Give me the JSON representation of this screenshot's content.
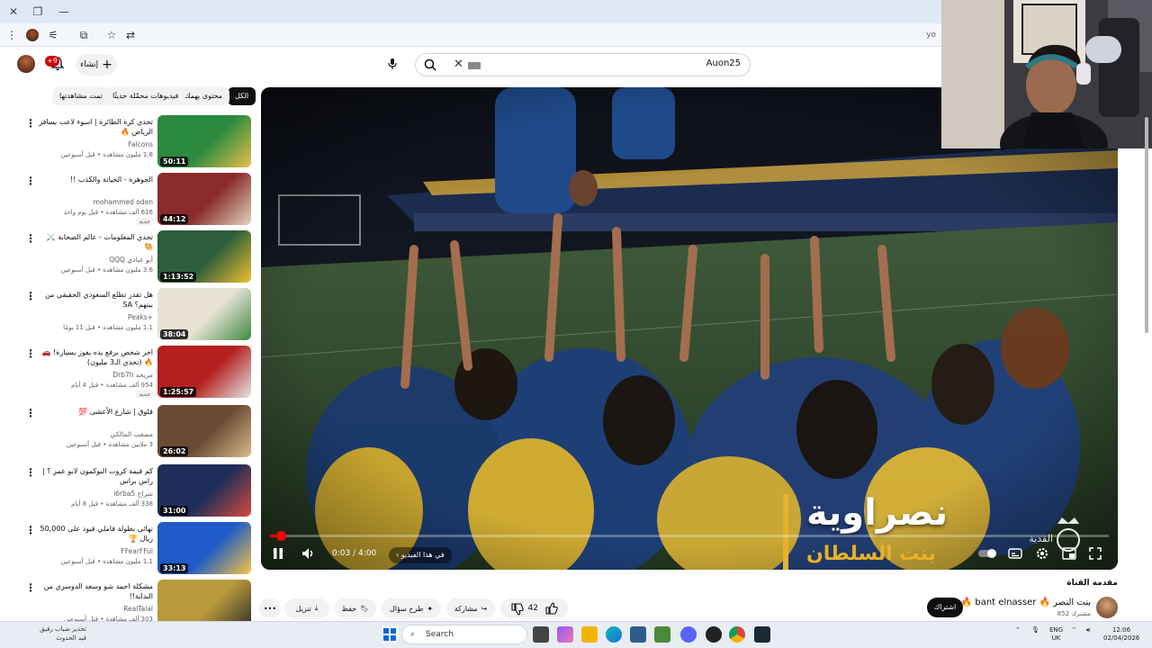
{
  "browser": {
    "url_fragment": "yo"
  },
  "header": {
    "notification_badge": "+9",
    "create_label": "إنشاء",
    "search_value": "Auon25"
  },
  "chips": [
    "الكل",
    "محتوى يهمك",
    "فيديوهات محمّلة حديثًا",
    "تمت مشاهدتها"
  ],
  "recommendations": [
    {
      "title": "تحدي كرة الطائرة | اسوء لاعب يسافر الرياض 🔥",
      "channel": "Falcons",
      "meta": "1.8 مليون مشاهدة • قبل أسبوعين",
      "duration": "50:11"
    },
    {
      "title": "الجوهرة - الخيانة والكذب !!",
      "channel": "mohammed oden",
      "meta": "616 ألف مشاهدة • قبل يوم واحد",
      "badge": "جديد",
      "duration": "44:12"
    },
    {
      "title": "تحدي المعلومات - عالم الصحابة ⚔️ 🐫",
      "channel": "QQQ أبو عبادي",
      "meta": "3.6 مليون مشاهدة • قبل أسبوعين",
      "duration": "1:13:52"
    },
    {
      "title": "هل تقدر تطلع السعودي الحقيقي من بينهم؟ SA",
      "channel": "Peaks+",
      "meta": "1.1 مليون مشاهدة • قبل 11 يومًا",
      "duration": "38:04"
    },
    {
      "title": "اخر شخص يرفع يده يفوز بسيارة! 🚗 🔥 (تحدي الـ3 مليون)",
      "channel": "Drb7h مريخه",
      "meta": "954 ألف مشاهدة • قبل 4 أيام",
      "badge": "جديد",
      "duration": "1:25:57"
    },
    {
      "title": "قلوق | شارع الأعشى 💯",
      "channel": "مصعب المالكي",
      "meta": "3 ملايين مشاهدة • قبل أسبوعين",
      "duration": "26:02"
    },
    {
      "title": "كم قيمة كروت البوكمون لابو عمر ؟ | راس براس",
      "channel": "i6rba5 شراح",
      "meta": "338 ألف مشاهدة • قبل 8 أيام",
      "duration": "31:00"
    },
    {
      "title": "نهائي بطولة فاملي فيود على 50,000 ريال 🏆",
      "channel": "FFearFFul",
      "meta": "1.1 مليون مشاهدة • قبل أسبوعين",
      "duration": "33:13"
    },
    {
      "title": "مشكلة احمد شو وسعد الدوسري من البداية!!",
      "channel": "RealTalal",
      "meta": "303 ألف مشاهدة • قبل أسبوعين",
      "duration": ""
    }
  ],
  "player": {
    "time": "0:03 / 4:00",
    "progress": 0.0125,
    "chapter_label": "في هذا الفيديو",
    "caption_main": "نصراوية",
    "caption_sub": "بنت السلطان",
    "watermark": "القدية"
  },
  "below": {
    "section_title": "مقدمة القناة",
    "channel_name": "بنت النصر 🔥 bant elnasser 🔥",
    "subscribers": "852 مشترك",
    "subscribe_label": "اشتراك",
    "likes": "42",
    "share_label": "مشاركة",
    "ask_label": "طرح سؤال",
    "save_label": "حفظ",
    "download_label": "تنزيل"
  },
  "taskbar": {
    "weather_line1": "تحذير ضباب رقيق",
    "weather_line2": "قيد الحدوث",
    "search_label": "Search",
    "lang_line1": "ENG",
    "lang_line2": "UK",
    "time": "12:06",
    "date": "02/04/2026"
  }
}
